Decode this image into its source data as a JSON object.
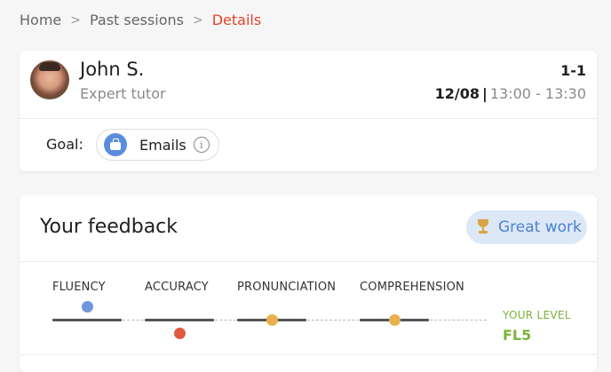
{
  "breadcrumb": {
    "home": "Home",
    "past_sessions": "Past sessions",
    "current": "Details",
    "separator": ">"
  },
  "tutor": {
    "name": "John S.",
    "role": "Expert tutor",
    "session_type": "1-1",
    "date": "12/08",
    "date_separator": "|",
    "time": "13:00 - 13:30"
  },
  "goal": {
    "label": "Goal:",
    "value": "Emails",
    "icon": "briefcase-icon",
    "info_icon": "info-icon",
    "info_glyph": "i"
  },
  "feedback": {
    "title": "Your feedback",
    "badge": "Great work",
    "badge_icon": "trophy-icon",
    "metrics": [
      {
        "label": "FLUENCY",
        "marker": "above",
        "color": "#6f97de"
      },
      {
        "label": "ACCURACY",
        "marker": "below",
        "color": "#e05a42"
      },
      {
        "label": "PRONUNCIATION",
        "marker": "on-line",
        "color": "#e8b14e"
      },
      {
        "label": "COMPREHENSION",
        "marker": "on-line",
        "color": "#e8b14e"
      }
    ],
    "level_label": "YOUR LEVEL",
    "level_value": "FL5"
  },
  "colors": {
    "accent": "#e0432b",
    "level_green": "#7bb33a",
    "badge_blue": "#4b82d0"
  }
}
